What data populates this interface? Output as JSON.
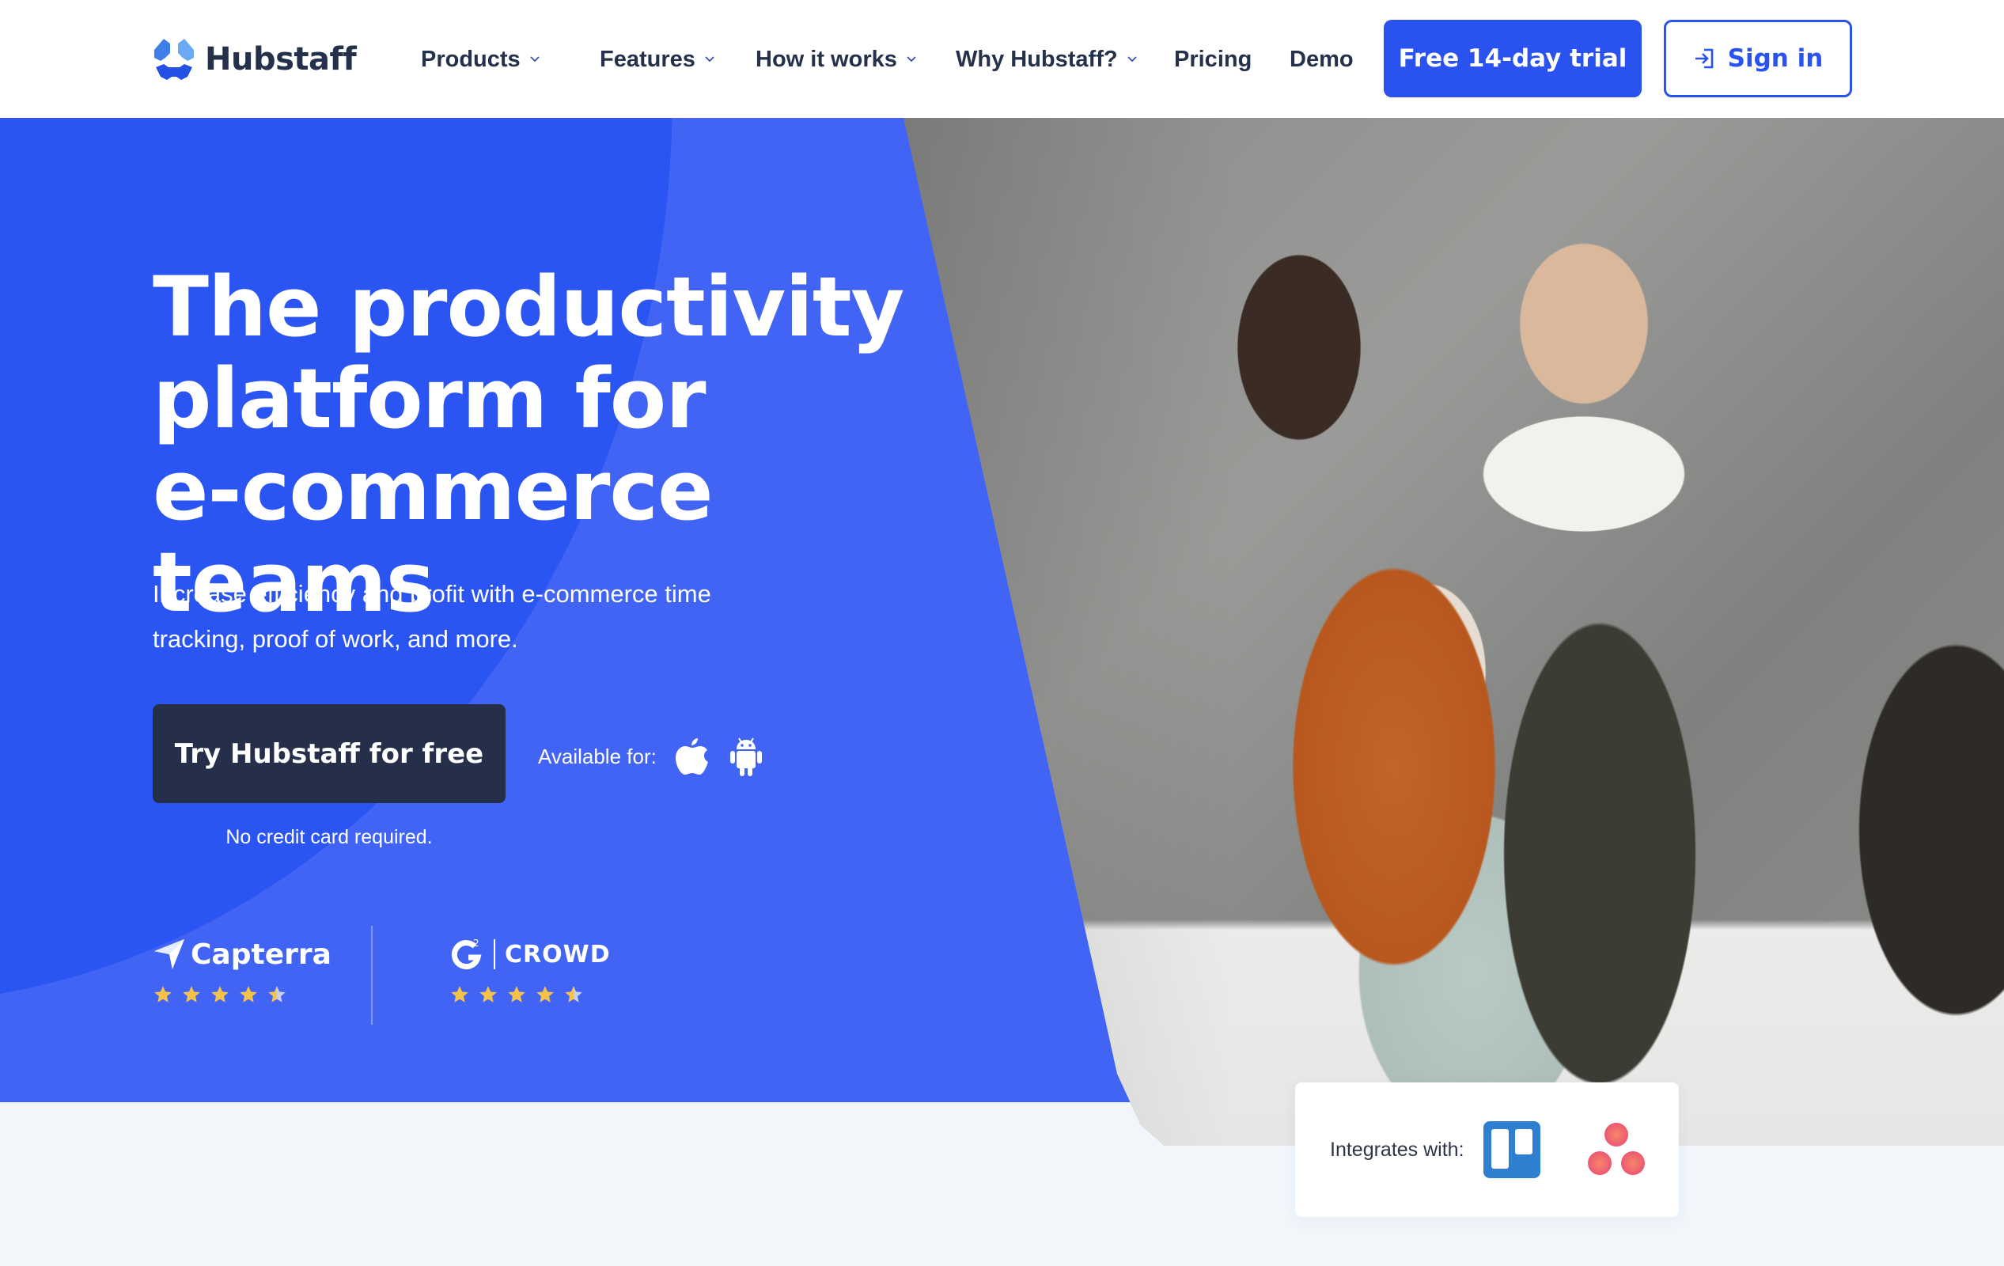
{
  "brand": {
    "name": "Hubstaff",
    "logo_icon": "hubstaff-logo-icon",
    "colors": {
      "primary": "#2a52ee",
      "hero_blue": "#4264f5",
      "hero_blue_dark": "#2b55f2",
      "navy": "#252f49",
      "text_dark": "#25314a",
      "star": "#f5c24a",
      "page_bg": "#f2f6fb"
    }
  },
  "nav": {
    "items": [
      {
        "label": "Products",
        "has_dropdown": true,
        "icon": "chevron-down-icon"
      },
      {
        "label": "Features",
        "has_dropdown": true,
        "icon": "chevron-down-icon"
      },
      {
        "label": "How it works",
        "has_dropdown": true,
        "icon": "chevron-down-icon"
      },
      {
        "label": "Why Hubstaff?",
        "has_dropdown": true,
        "icon": "chevron-down-icon"
      },
      {
        "label": "Pricing",
        "has_dropdown": false
      },
      {
        "label": "Demo",
        "has_dropdown": false
      }
    ],
    "trial_button": "Free 14-day trial",
    "signin_button": "Sign in",
    "signin_icon": "sign-in-icon"
  },
  "hero": {
    "headline_lines": [
      "The productivity",
      "platform for",
      "e-commerce teams"
    ],
    "subtext": "Increase efficiency and profit with e-commerce time tracking, proof of work, and more.",
    "cta_button": "Try Hubstaff for free",
    "cta_note": "No credit card required.",
    "available_label": "Available for:",
    "platforms": [
      {
        "name": "Apple",
        "icon": "apple-icon"
      },
      {
        "name": "Android",
        "icon": "android-icon"
      }
    ],
    "photo_alt": "Team of colleagues talking in an office"
  },
  "reviews": [
    {
      "site": "Capterra",
      "icon": "capterra-logo-icon",
      "rating": 4.5,
      "max": 5
    },
    {
      "site": "CROWD",
      "prefix": "G2",
      "icon": "g2-logo-icon",
      "rating": 4.5,
      "max": 5
    }
  ],
  "integrations": {
    "label": "Integrates with:",
    "apps": [
      {
        "name": "Trello",
        "icon": "trello-icon",
        "color": "#2f7fd1"
      },
      {
        "name": "Asana",
        "icon": "asana-icon",
        "color": "#ec5d74"
      }
    ]
  }
}
